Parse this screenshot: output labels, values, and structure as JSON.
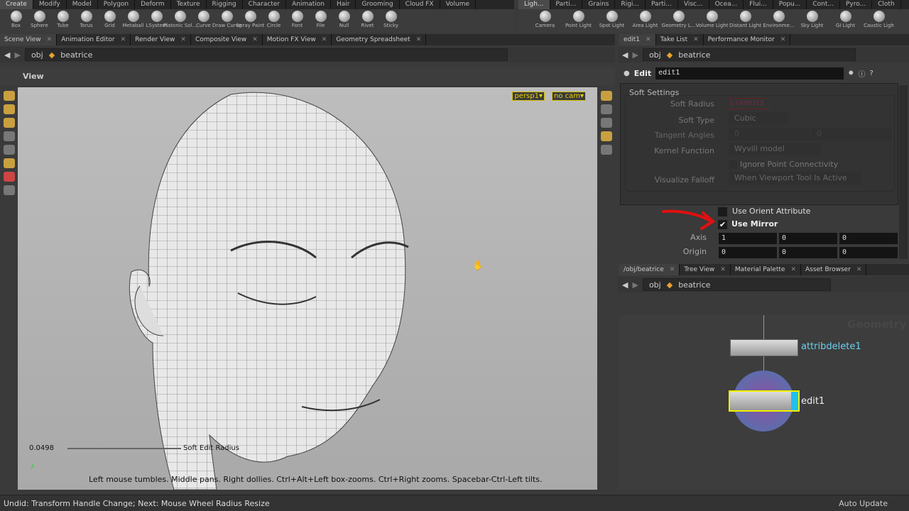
{
  "shelf_left": {
    "tabs": [
      "Create",
      "Modify",
      "Model",
      "Polygon",
      "Deform",
      "Texture",
      "Rigging",
      "Character",
      "Animation",
      "Hair",
      "Grooming",
      "Cloud FX",
      "Volume"
    ],
    "tools": [
      "Box",
      "Sphere",
      "Tube",
      "Torus",
      "Grid",
      "Metaball",
      "LSystem",
      "Platonic Sol...",
      "Curve",
      "Draw Curve",
      "Spray Paint",
      "Circle",
      "Font",
      "File",
      "Null",
      "Rivet",
      "Sticky"
    ]
  },
  "shelf_right": {
    "tabs": [
      "Ligh...",
      "Parti...",
      "Grains",
      "Rigi...",
      "Parti...",
      "Visc...",
      "Ocea...",
      "Flui...",
      "Popu...",
      "Cont...",
      "Pyro...",
      "Cloth"
    ],
    "tools": [
      "Camera",
      "Point Light",
      "Spot Light",
      "Area Light",
      "Geometry L...",
      "Volume Light",
      "Distant Light",
      "Environme...",
      "Sky Light",
      "GI Light",
      "Caustic Ligh"
    ]
  },
  "left_pane": {
    "tabs": [
      "Scene View",
      "Animation Editor",
      "Render View",
      "Composite View",
      "Motion FX View",
      "Geometry Spreadsheet"
    ],
    "path": [
      "obj",
      "beatrice"
    ],
    "view_title": "View",
    "camera": "persp1▾",
    "cam_select": "no cam▾",
    "radius_value": "0.0498",
    "radius_label": "Soft Edit Radius",
    "hint": "Left mouse tumbles. Middle pans. Right dollies. Ctrl+Alt+Left box-zooms. Ctrl+Right zooms. Spacebar-Ctrl-Left tilts."
  },
  "param_pane": {
    "tabs": [
      "edit1",
      "Take List",
      "Performance Monitor"
    ],
    "path": [
      "obj",
      "beatrice"
    ],
    "node_type": "Edit",
    "node_name": "edit1",
    "section": "Soft Settings",
    "soft_radius_label": "Soft Radius",
    "soft_radius": "0.0498315",
    "soft_type_label": "Soft Type",
    "soft_type": "Cubic",
    "tangent_label": "Tangent Angles",
    "tangent": [
      "0",
      "0"
    ],
    "kernel_label": "Kernel Function",
    "kernel": "Wyvill model",
    "ignore_label": "Ignore Point Connectivity",
    "visualize_label": "Visualize Falloff",
    "visualize": "When Viewport Tool Is Active",
    "orient_label": "Use Orient Attribute",
    "mirror_label": "Use Mirror",
    "mirror_checked": true,
    "axis_label": "Axis",
    "axis": [
      "1",
      "0",
      "0"
    ],
    "origin_label": "Origin",
    "origin": [
      "0",
      "0",
      "0"
    ]
  },
  "network_pane": {
    "tabs": [
      "/obj/beatrice",
      "Tree View",
      "Material Palette",
      "Asset Browser"
    ],
    "path": [
      "obj",
      "beatrice"
    ],
    "watermark": "Geometry",
    "nodes": [
      "attribdelete1",
      "edit1"
    ]
  },
  "status": {
    "text": "Undid: Transform Handle Change; Next: Mouse Wheel Radius Resize",
    "update_mode": "Auto Update"
  }
}
